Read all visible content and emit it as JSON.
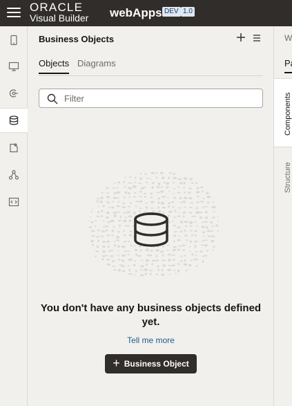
{
  "header": {
    "brand_line1": "ORACLE",
    "brand_line2": "Visual Builder",
    "app_name": "webApps",
    "env_badge": "DEV",
    "version_badge": "1.0",
    "bg_color": "#312d2a"
  },
  "rail": {
    "items": [
      {
        "icon": "mobile-icon",
        "active": false
      },
      {
        "icon": "desktop-icon",
        "active": false
      },
      {
        "icon": "service-connections-icon",
        "active": false
      },
      {
        "icon": "database-icon",
        "active": true
      },
      {
        "icon": "component-icon",
        "active": false
      },
      {
        "icon": "processes-icon",
        "active": false
      },
      {
        "icon": "source-code-icon",
        "active": false
      }
    ]
  },
  "panel": {
    "title": "Business Objects",
    "tabs": [
      {
        "label": "Objects",
        "active": true
      },
      {
        "label": "Diagrams",
        "active": false
      }
    ],
    "filter_placeholder": "Filter",
    "empty_message": "You don't have any business objects defined yet.",
    "tell_more": "Tell me more",
    "add_button": "Business Object"
  },
  "right_panel": {
    "top_label": "W",
    "tab_label": "Pa",
    "vertical_tabs": [
      "Components",
      "Structure"
    ]
  }
}
